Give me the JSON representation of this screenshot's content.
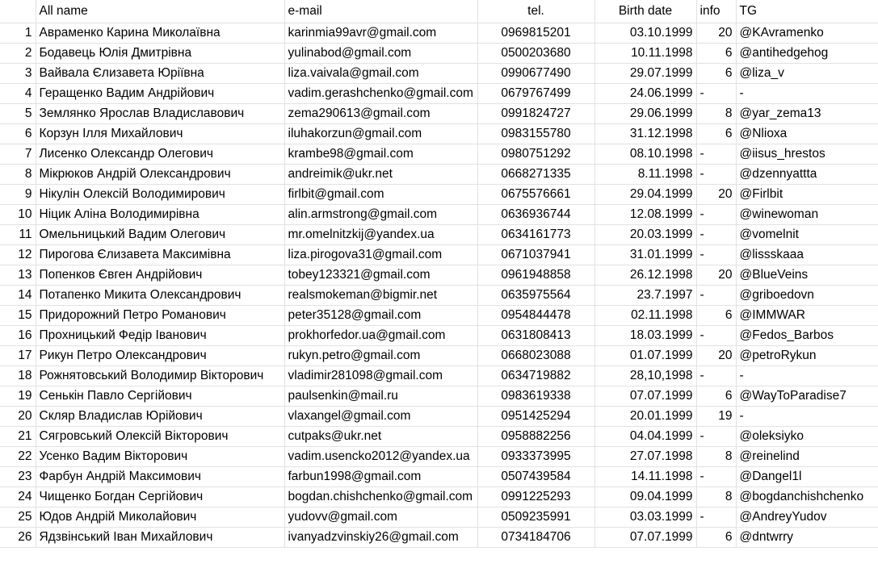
{
  "header": {
    "name": "All name",
    "email": "e-mail",
    "tel": "tel.",
    "birth": "Birth date",
    "info": "info",
    "tg": "TG"
  },
  "rows": [
    {
      "n": "1",
      "name": "Авраменко Карина Миколаївна",
      "email": "karinmia99avr@gmail.com",
      "tel": "0969815201",
      "birth": "03.10.1999",
      "info": "20",
      "tg": "@KAvramenko"
    },
    {
      "n": "2",
      "name": "Бодавець Юлія Дмитрівна",
      "email": "yulinabod@gmail.com",
      "tel": "0500203680",
      "birth": "10.11.1998",
      "info": "6",
      "tg": "@antihedgehog"
    },
    {
      "n": "3",
      "name": "Вайвала Єлизавета Юріївна",
      "email": "liza.vaivala@gmail.com",
      "tel": "0990677490",
      "birth": "29.07.1999",
      "info": "6",
      "tg": "@liza_v"
    },
    {
      "n": "4",
      "name": "Геращенко Вадим Андрійович",
      "email": "vadim.gerashchenko@gmail.com",
      "tel": "0679767499",
      "birth": "24.06.1999",
      "info": "-",
      "tg": "-"
    },
    {
      "n": "5",
      "name": "Землянко Ярослав Владиславович",
      "email": "zema290613@gmail.com",
      "tel": "0991824727",
      "birth": "29.06.1999",
      "info": "8",
      "tg": "@yar_zema13"
    },
    {
      "n": "6",
      "name": "Корзун Ілля Михайлович",
      "email": "iluhakorzun@gmail.com",
      "tel": "0983155780",
      "birth": "31.12.1998",
      "info": "6",
      "tg": "@Nlioxa"
    },
    {
      "n": "7",
      "name": "Лисенко Олександр Олегович",
      "email": "krambe98@gmail.com",
      "tel": "0980751292",
      "birth": "08.10.1998",
      "info": "-",
      "tg": "@iisus_hrestos"
    },
    {
      "n": "8",
      "name": "Мікрюков Андрій Олександрович",
      "email": "andreimik@ukr.net",
      "tel": "0668271335",
      "birth": "8.11.1998",
      "info": "-",
      "tg": "@dzennyattta"
    },
    {
      "n": "9",
      "name": "Нікулін Олексій Володимирович",
      "email": "firlbit@gmail.com",
      "tel": "0675576661",
      "birth": "29.04.1999",
      "info": "20",
      "tg": "@Firlbit"
    },
    {
      "n": "10",
      "name": "Ніцик Аліна Володимирівна",
      "email": "alin.armstrong@gmail.com",
      "tel": "0636936744",
      "birth": "12.08.1999",
      "info": "-",
      "tg": "@winewoman"
    },
    {
      "n": "11",
      "name": "Омельницький Вадим Олегович",
      "email": "mr.omelnitzkij@yandex.ua",
      "tel": "0634161773",
      "birth": "20.03.1999",
      "info": "-",
      "tg": "@vomelnit"
    },
    {
      "n": "12",
      "name": "Пирогова Єлизавета Максимівна",
      "email": "liza.pirogova31@gmail.com",
      "tel": "0671037941",
      "birth": "31.01.1999",
      "info": "-",
      "tg": "@lissskaaa"
    },
    {
      "n": "13",
      "name": "Попенков Євген Андрійович",
      "email": "tobey123321@gmail.com",
      "tel": "0961948858",
      "birth": "26.12.1998",
      "info": "20",
      "tg": "@BlueVeins"
    },
    {
      "n": "14",
      "name": "Потапенко Микита Олександрович",
      "email": "realsmokeman@bigmir.net",
      "tel": "0635975564",
      "birth": "23.7.1997",
      "info": "-",
      "tg": "@griboedovn"
    },
    {
      "n": "15",
      "name": "Придорожний Петро Романович",
      "email": "peter35128@gmail.com",
      "tel": "0954844478",
      "birth": "02.11.1998",
      "info": "6",
      "tg": "@IMMWAR"
    },
    {
      "n": "16",
      "name": "Прохницький Федір Іванович",
      "email": "prokhorfedor.ua@gmail.com",
      "tel": "0631808413",
      "birth": "18.03.1999",
      "info": "-",
      "tg": "@Fedos_Barbos"
    },
    {
      "n": "17",
      "name": "Рикун Петро Олександрович",
      "email": "rukyn.petro@gmail.com",
      "tel": "0668023088",
      "birth": "01.07.1999",
      "info": "20",
      "tg": "@petroRykun"
    },
    {
      "n": "18",
      "name": "Рожнятовський Володимир Вікторович",
      "email": "vladimir281098@gmail.com",
      "tel": "0634719882",
      "birth": "28,10,1998",
      "info": "-",
      "tg": "-"
    },
    {
      "n": "19",
      "name": "Сенькін Павло Сергійович",
      "email": "paulsenkin@mail.ru",
      "tel": "0983619338",
      "birth": "07.07.1999",
      "info": "6",
      "tg": "@WayToParadise7"
    },
    {
      "n": "20",
      "name": "Скляр Владислав Юрійович",
      "email": "vlaxangel@gmail.com",
      "tel": "0951425294",
      "birth": "20.01.1999",
      "info": "19",
      "tg": "-"
    },
    {
      "n": "21",
      "name": "Сягровський Олексій Вікторович",
      "email": "cutpaks@ukr.net",
      "tel": "0958882256",
      "birth": "04.04.1999",
      "info": "-",
      "tg": "@oleksiyko"
    },
    {
      "n": "22",
      "name": "Усенко Вадим Вікторович",
      "email": "vadim.usencko2012@yandex.ua",
      "tel": "0933373995",
      "birth": "27.07.1998",
      "info": "8",
      "tg": "@reinelind"
    },
    {
      "n": "23",
      "name": "Фарбун Андрій Максимович",
      "email": "farbun1998@gmail.com",
      "tel": "0507439584",
      "birth": "14.11.1998",
      "info": "-",
      "tg": "@Dangel1l"
    },
    {
      "n": "24",
      "name": "Чищенко Богдан Сергійович",
      "email": "bogdan.chishchenko@gmail.com",
      "tel": "0991225293",
      "birth": "09.04.1999",
      "info": "8",
      "tg": "@bogdanchishchenko"
    },
    {
      "n": "25",
      "name": "Юдов Андрій Миколайович",
      "email": "yudovv@gmail.com",
      "tel": "0509235991",
      "birth": "03.03.1999",
      "info": "-",
      "tg": "@AndreyYudov"
    },
    {
      "n": "26",
      "name": "Ядзвінський Іван Михайлович",
      "email": "ivanyadzvinskiy26@gmail.com",
      "tel": "0734184706",
      "birth": "07.07.1999",
      "info": "6",
      "tg": "@dntwrry"
    }
  ]
}
